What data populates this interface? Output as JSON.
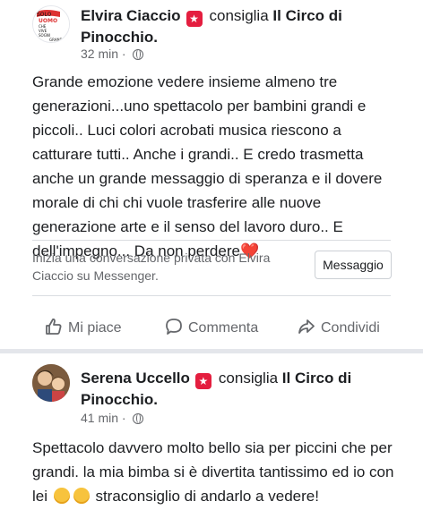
{
  "posts": [
    {
      "author": "Elvira Ciaccio",
      "recommends": "consiglia",
      "page": "Il Circo di Pinocchio.",
      "time": "32 min",
      "separator": "·",
      "text_lines": [
        "Grande emozione vedere insieme almeno tre",
        "generazioni...uno spettacolo per bambini grandi e",
        "piccoli.. Luci colori acrobati musica riescono a",
        "catturare tutti.. Anche i grandi.. E credo trasmetta",
        "anche un grande messaggio di speranza e il dovere",
        "morale di chi chi vuole trasferire alle nuove",
        "generazione arte e il senso del lavoro duro.. E",
        "dell'impegno... Da non perdere"
      ],
      "text_end_emoji": "❤️",
      "avatar_text_lines": [
        "SOLO",
        "UOMO",
        "CHE",
        "VIVE",
        "SOGNI",
        "GRANDI"
      ],
      "messenger_prompt": "Inizia una conversazione privata con Elvira Ciaccio su Messenger.",
      "messenger_button": "Messaggio"
    },
    {
      "author": "Serena Uccello",
      "recommends": "consiglia",
      "page": "Il Circo di Pinocchio.",
      "time": "41 min",
      "separator": "·",
      "text_part1": "Spettacolo davvero molto bello sia per piccini che per grandi. la mia bimba si è divertita tantissimo ed io con lei ",
      "text_part2": " straconsiglio di andarlo a vedere!"
    }
  ],
  "actions": {
    "like": "Mi piace",
    "comment": "Commenta",
    "share": "Condividi"
  },
  "icons": {
    "recommend_badge": "star-badge-icon",
    "privacy": "globe-icon",
    "like": "thumbs-up-icon",
    "comment": "speech-bubble-icon",
    "share": "share-arrow-icon"
  },
  "colors": {
    "badge": "#e41e3f",
    "secondary_text": "#65676b",
    "divider": "#dadde1"
  }
}
